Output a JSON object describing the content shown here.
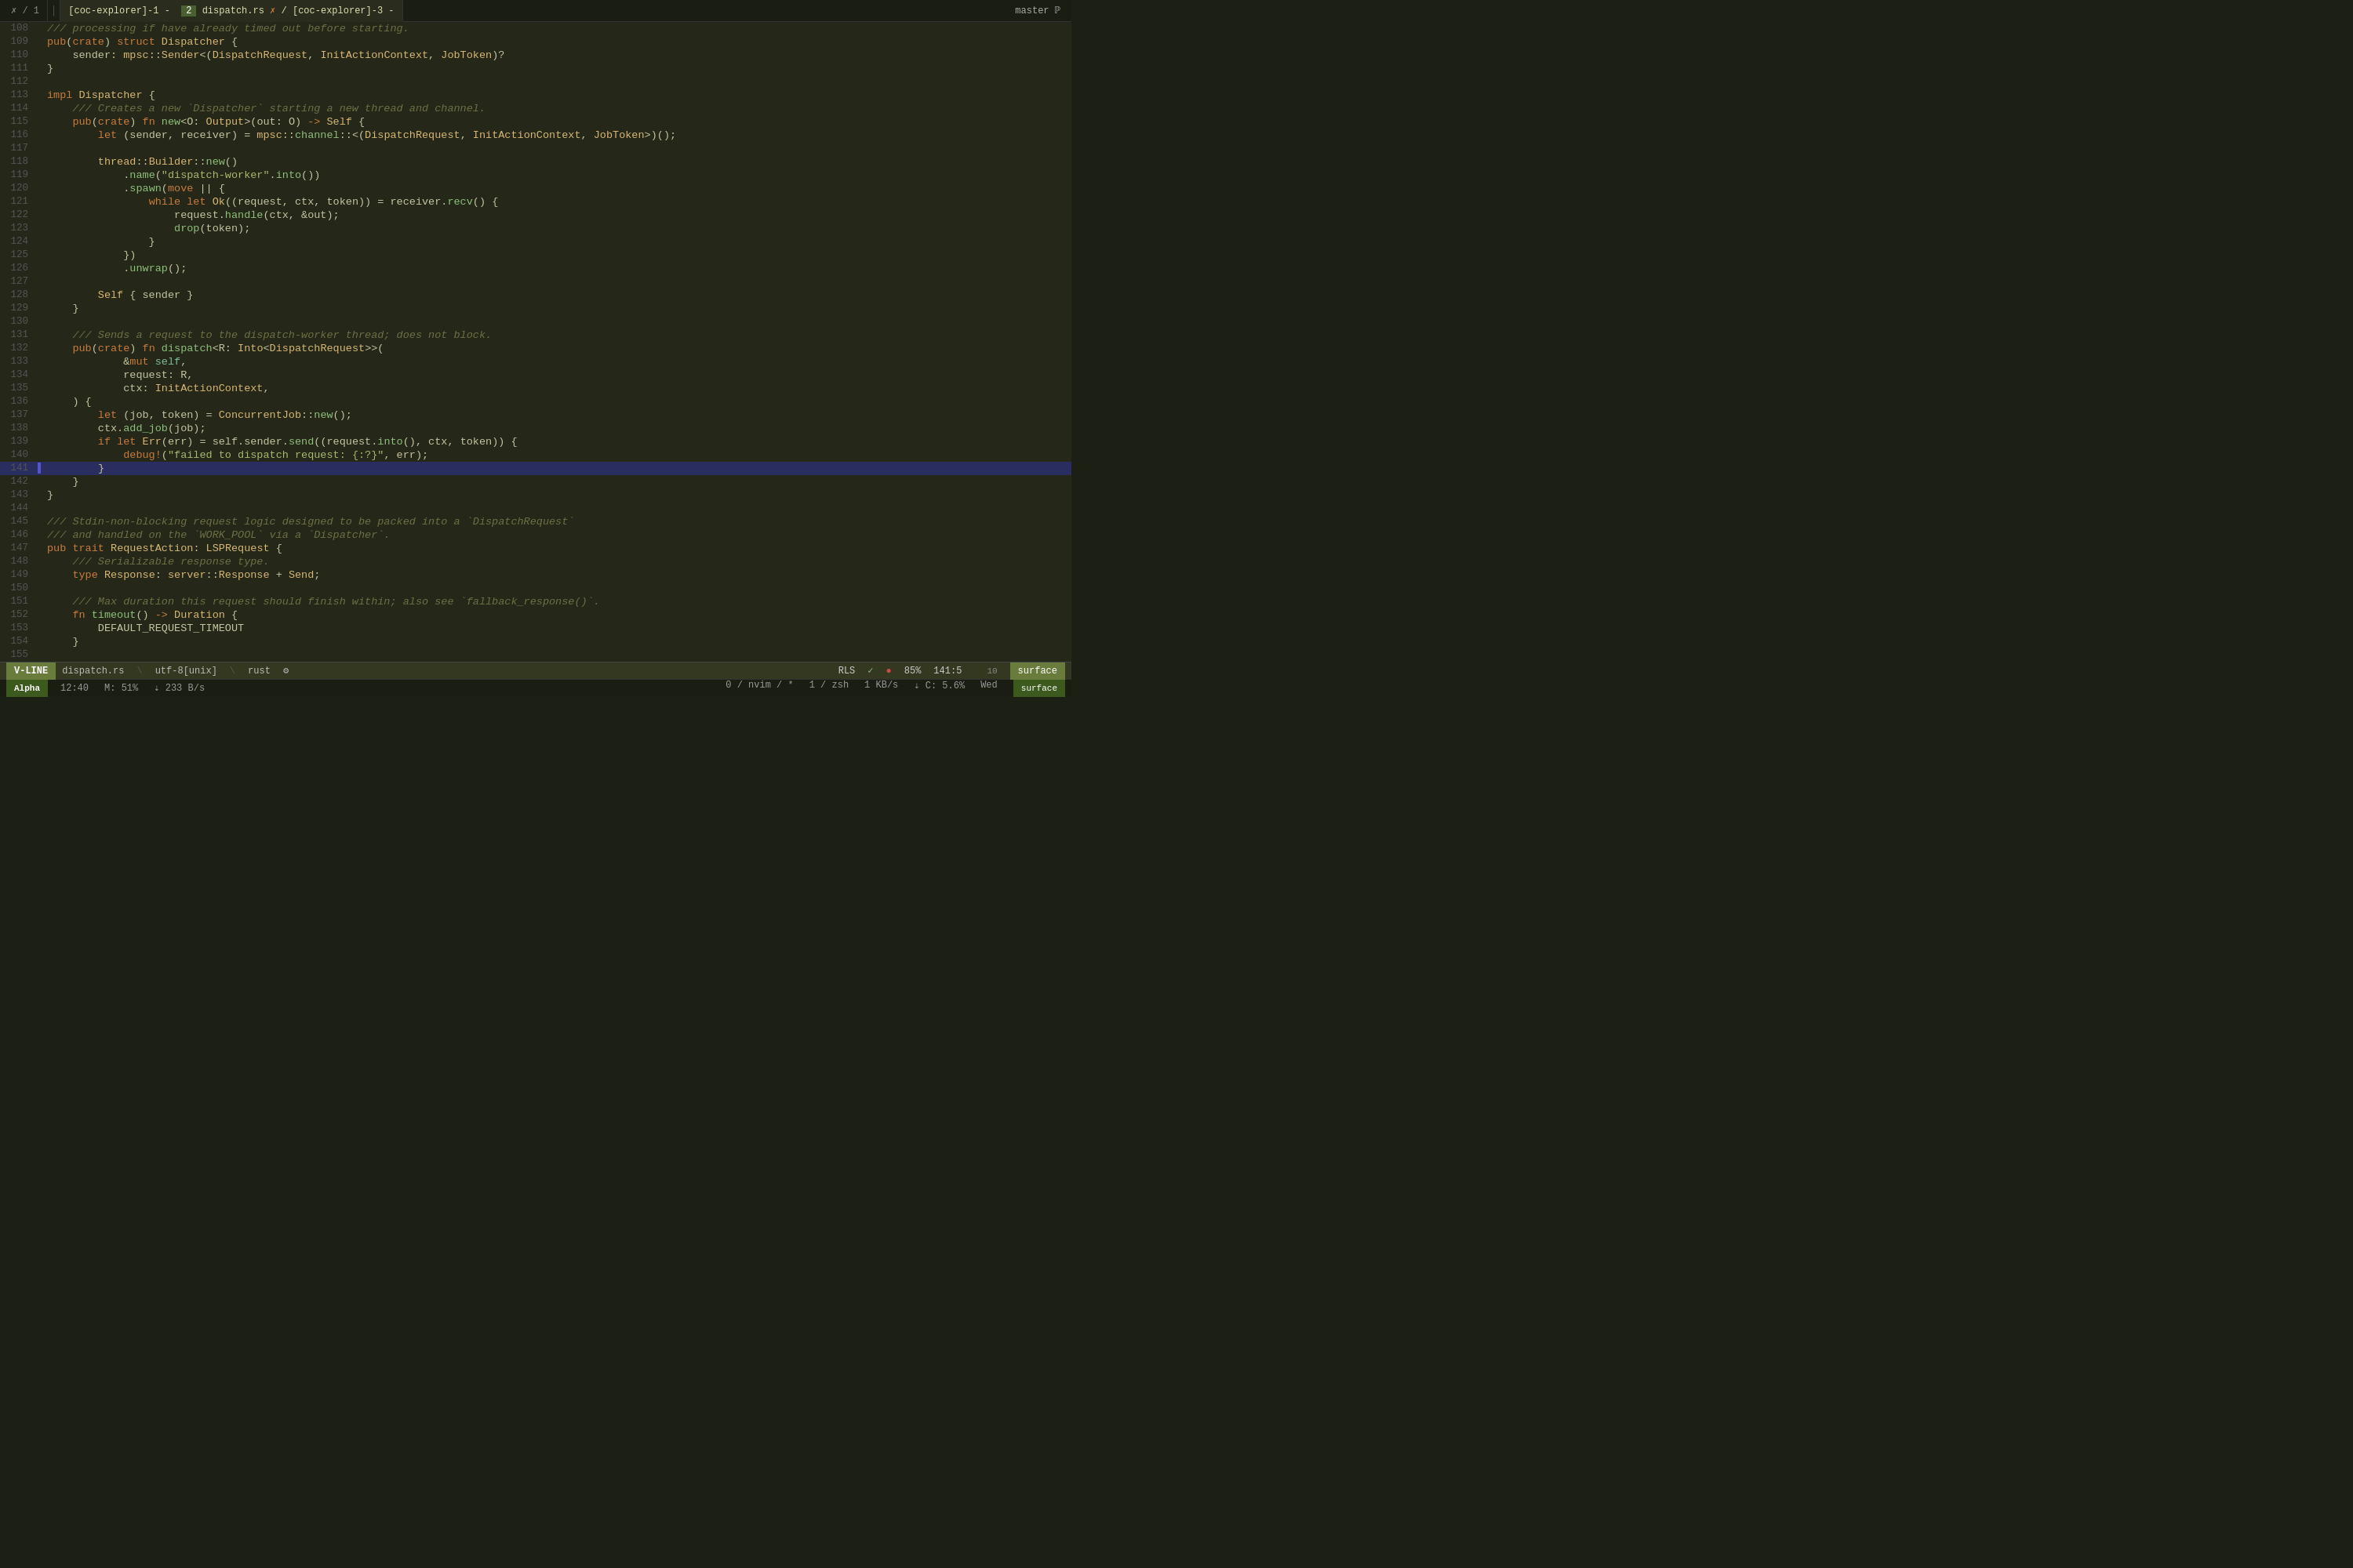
{
  "tabs": [
    {
      "id": 1,
      "label": "✗ / 1",
      "active": false
    },
    {
      "id": 2,
      "label": "[coc-explorer]-1 -  2  dispatch.rs  ✗ / [coc-explorer]-3 -",
      "active": true
    }
  ],
  "branch": "master ℙ",
  "filename": "dispatch.rs",
  "encoding": "utf-8[unix]",
  "filetype": "rust",
  "lsp": "RLS",
  "lsp_check": "✓",
  "lsp_dot": "●",
  "zoom": "85%",
  "position": "141:5",
  "scroll_pct": "10",
  "mode": "V-LINE",
  "time": "12:40",
  "mem": "M: 51%",
  "transfer": "⇣ 233 B/s",
  "nvim_info": "0 / nvim / *",
  "jobs": "1 / zsh",
  "kb": "1 KB/s",
  "cpu": "⇣ C: 5.6%",
  "day": "Wed",
  "surface": "surface",
  "lines": [
    {
      "n": 108,
      "indent": 0,
      "tokens": [
        {
          "t": "cmt",
          "v": "/// processing if have already timed out before starting."
        }
      ]
    },
    {
      "n": 109,
      "indent": 0,
      "tokens": [
        {
          "t": "kw",
          "v": "pub"
        },
        {
          "t": "normal",
          "v": "("
        },
        {
          "t": "kw",
          "v": "crate"
        },
        {
          "t": "normal",
          "v": ") "
        },
        {
          "t": "kw",
          "v": "struct"
        },
        {
          "t": "normal",
          "v": " "
        },
        {
          "t": "type",
          "v": "Dispatcher"
        },
        {
          "t": "normal",
          "v": " {"
        }
      ]
    },
    {
      "n": 110,
      "indent": 1,
      "tokens": [
        {
          "t": "normal",
          "v": "    sender: "
        },
        {
          "t": "type",
          "v": "mpsc"
        },
        {
          "t": "normal",
          "v": "::"
        },
        {
          "t": "type",
          "v": "Sender"
        },
        {
          "t": "normal",
          "v": "<("
        },
        {
          "t": "type",
          "v": "DispatchRequest"
        },
        {
          "t": "normal",
          "v": ", "
        },
        {
          "t": "type",
          "v": "InitActionContext"
        },
        {
          "t": "normal",
          "v": ", "
        },
        {
          "t": "type",
          "v": "JobToken"
        },
        {
          "t": "normal",
          "v": ")?"
        }
      ]
    },
    {
      "n": 111,
      "indent": 0,
      "tokens": [
        {
          "t": "normal",
          "v": "}"
        }
      ]
    },
    {
      "n": 112,
      "indent": 0,
      "tokens": []
    },
    {
      "n": 113,
      "indent": 0,
      "tokens": [
        {
          "t": "kw",
          "v": "impl"
        },
        {
          "t": "normal",
          "v": " "
        },
        {
          "t": "type",
          "v": "Dispatcher"
        },
        {
          "t": "normal",
          "v": " {"
        }
      ]
    },
    {
      "n": 114,
      "indent": 1,
      "tokens": [
        {
          "t": "normal",
          "v": "    "
        },
        {
          "t": "cmt",
          "v": "/// Creates a new `Dispatcher` starting a new thread and channel."
        }
      ]
    },
    {
      "n": 115,
      "indent": 1,
      "tokens": [
        {
          "t": "normal",
          "v": "    "
        },
        {
          "t": "kw",
          "v": "pub"
        },
        {
          "t": "normal",
          "v": "("
        },
        {
          "t": "kw",
          "v": "crate"
        },
        {
          "t": "normal",
          "v": ") "
        },
        {
          "t": "kw",
          "v": "fn"
        },
        {
          "t": "normal",
          "v": " "
        },
        {
          "t": "func",
          "v": "new"
        },
        {
          "t": "normal",
          "v": "<O: "
        },
        {
          "t": "type",
          "v": "Output"
        },
        {
          "t": "normal",
          "v": ">(out: O) "
        },
        {
          "t": "arrow",
          "v": "->"
        },
        {
          "t": "normal",
          "v": " "
        },
        {
          "t": "type",
          "v": "Self"
        },
        {
          "t": "normal",
          "v": " {"
        }
      ]
    },
    {
      "n": 116,
      "indent": 2,
      "tokens": [
        {
          "t": "normal",
          "v": "        "
        },
        {
          "t": "kw",
          "v": "let"
        },
        {
          "t": "normal",
          "v": " (sender, receiver) = "
        },
        {
          "t": "type",
          "v": "mpsc"
        },
        {
          "t": "normal",
          "v": "::"
        },
        {
          "t": "func",
          "v": "channel"
        },
        {
          "t": "normal",
          "v": "::<("
        },
        {
          "t": "type",
          "v": "DispatchRequest"
        },
        {
          "t": "normal",
          "v": ", "
        },
        {
          "t": "type",
          "v": "InitActionContext"
        },
        {
          "t": "normal",
          "v": ", "
        },
        {
          "t": "type",
          "v": "JobToken"
        },
        {
          "t": "normal",
          "v": ">)();"
        }
      ]
    },
    {
      "n": 117,
      "indent": 0,
      "tokens": []
    },
    {
      "n": 118,
      "indent": 2,
      "tokens": [
        {
          "t": "normal",
          "v": "        "
        },
        {
          "t": "type",
          "v": "thread"
        },
        {
          "t": "normal",
          "v": "::"
        },
        {
          "t": "type",
          "v": "Builder"
        },
        {
          "t": "normal",
          "v": "::"
        },
        {
          "t": "func",
          "v": "new"
        },
        {
          "t": "normal",
          "v": "()"
        }
      ]
    },
    {
      "n": 119,
      "indent": 3,
      "tokens": [
        {
          "t": "normal",
          "v": "            ."
        },
        {
          "t": "func",
          "v": "name"
        },
        {
          "t": "normal",
          "v": "("
        },
        {
          "t": "str",
          "v": "\"dispatch-worker\""
        },
        {
          "t": "normal",
          "v": "."
        },
        {
          "t": "func",
          "v": "into"
        },
        {
          "t": "normal",
          "v": "())"
        }
      ]
    },
    {
      "n": 120,
      "indent": 3,
      "tokens": [
        {
          "t": "normal",
          "v": "            ."
        },
        {
          "t": "func",
          "v": "spawn"
        },
        {
          "t": "normal",
          "v": "("
        },
        {
          "t": "kw",
          "v": "move"
        },
        {
          "t": "normal",
          "v": " || {"
        }
      ]
    },
    {
      "n": 121,
      "indent": 4,
      "tokens": [
        {
          "t": "normal",
          "v": "                "
        },
        {
          "t": "kw",
          "v": "while"
        },
        {
          "t": "normal",
          "v": " "
        },
        {
          "t": "kw",
          "v": "let"
        },
        {
          "t": "normal",
          "v": " "
        },
        {
          "t": "type",
          "v": "Ok"
        },
        {
          "t": "normal",
          "v": "((request, ctx, token)) = receiver."
        },
        {
          "t": "func",
          "v": "recv"
        },
        {
          "t": "normal",
          "v": "() {"
        }
      ]
    },
    {
      "n": 122,
      "indent": 5,
      "tokens": [
        {
          "t": "normal",
          "v": "                    request."
        },
        {
          "t": "func",
          "v": "handle"
        },
        {
          "t": "normal",
          "v": "(ctx, &out);"
        }
      ]
    },
    {
      "n": 123,
      "indent": 5,
      "tokens": [
        {
          "t": "normal",
          "v": "                    "
        },
        {
          "t": "func",
          "v": "drop"
        },
        {
          "t": "normal",
          "v": "(token);"
        }
      ]
    },
    {
      "n": 124,
      "indent": 4,
      "tokens": [
        {
          "t": "normal",
          "v": "                }"
        }
      ]
    },
    {
      "n": 125,
      "indent": 3,
      "tokens": [
        {
          "t": "normal",
          "v": "            })"
        }
      ]
    },
    {
      "n": 126,
      "indent": 3,
      "tokens": [
        {
          "t": "normal",
          "v": "            ."
        },
        {
          "t": "func",
          "v": "unwrap"
        },
        {
          "t": "normal",
          "v": "();"
        }
      ]
    },
    {
      "n": 127,
      "indent": 0,
      "tokens": []
    },
    {
      "n": 128,
      "indent": 2,
      "tokens": [
        {
          "t": "normal",
          "v": "        "
        },
        {
          "t": "type",
          "v": "Self"
        },
        {
          "t": "normal",
          "v": " { sender }"
        }
      ]
    },
    {
      "n": 129,
      "indent": 1,
      "tokens": [
        {
          "t": "normal",
          "v": "    }"
        }
      ]
    },
    {
      "n": 130,
      "indent": 0,
      "tokens": []
    },
    {
      "n": 131,
      "indent": 1,
      "tokens": [
        {
          "t": "normal",
          "v": "    "
        },
        {
          "t": "cmt",
          "v": "/// Sends a request to the dispatch-worker thread; does not block."
        }
      ]
    },
    {
      "n": 132,
      "indent": 1,
      "tokens": [
        {
          "t": "normal",
          "v": "    "
        },
        {
          "t": "kw",
          "v": "pub"
        },
        {
          "t": "normal",
          "v": "("
        },
        {
          "t": "kw",
          "v": "crate"
        },
        {
          "t": "normal",
          "v": ") "
        },
        {
          "t": "kw",
          "v": "fn"
        },
        {
          "t": "normal",
          "v": " "
        },
        {
          "t": "func",
          "v": "dispatch"
        },
        {
          "t": "normal",
          "v": "<R: "
        },
        {
          "t": "type",
          "v": "Into"
        },
        {
          "t": "normal",
          "v": "<"
        },
        {
          "t": "type",
          "v": "DispatchRequest"
        },
        {
          "t": "normal",
          "v": ">>( "
        }
      ]
    },
    {
      "n": 133,
      "indent": 2,
      "tokens": [
        {
          "t": "normal",
          "v": "            &"
        },
        {
          "t": "kw",
          "v": "mut"
        },
        {
          "t": "normal",
          "v": " "
        },
        {
          "t": "kw2",
          "v": "self"
        },
        {
          "t": "normal",
          "v": ","
        }
      ]
    },
    {
      "n": 134,
      "indent": 2,
      "tokens": [
        {
          "t": "normal",
          "v": "            request: R,"
        }
      ]
    },
    {
      "n": 135,
      "indent": 2,
      "tokens": [
        {
          "t": "normal",
          "v": "            ctx: "
        },
        {
          "t": "type",
          "v": "InitActionContext"
        },
        {
          "t": "normal",
          "v": ","
        }
      ]
    },
    {
      "n": 136,
      "indent": 1,
      "tokens": [
        {
          "t": "normal",
          "v": "    ) {"
        }
      ]
    },
    {
      "n": 137,
      "indent": 2,
      "tokens": [
        {
          "t": "normal",
          "v": "        "
        },
        {
          "t": "kw",
          "v": "let"
        },
        {
          "t": "normal",
          "v": " (job, token) = "
        },
        {
          "t": "type",
          "v": "ConcurrentJob"
        },
        {
          "t": "normal",
          "v": "::"
        },
        {
          "t": "func",
          "v": "new"
        },
        {
          "t": "normal",
          "v": "();"
        }
      ]
    },
    {
      "n": 138,
      "indent": 2,
      "tokens": [
        {
          "t": "normal",
          "v": "        ctx."
        },
        {
          "t": "func",
          "v": "add_job"
        },
        {
          "t": "normal",
          "v": "(job);"
        }
      ]
    },
    {
      "n": 139,
      "indent": 2,
      "tokens": [
        {
          "t": "normal",
          "v": "        "
        },
        {
          "t": "kw",
          "v": "if"
        },
        {
          "t": "normal",
          "v": " "
        },
        {
          "t": "kw",
          "v": "let"
        },
        {
          "t": "normal",
          "v": " "
        },
        {
          "t": "type",
          "v": "Err"
        },
        {
          "t": "normal",
          "v": "(err) = self.sender."
        },
        {
          "t": "func",
          "v": "send"
        },
        {
          "t": "normal",
          "v": "((request."
        },
        {
          "t": "func",
          "v": "into"
        },
        {
          "t": "normal",
          "v": "(), ctx, token)) {"
        }
      ]
    },
    {
      "n": 140,
      "indent": 3,
      "tokens": [
        {
          "t": "normal",
          "v": "            "
        },
        {
          "t": "mac",
          "v": "debug!"
        },
        {
          "t": "normal",
          "v": "("
        },
        {
          "t": "str",
          "v": "\"failed to dispatch request: {:?}\""
        },
        {
          "t": "normal",
          "v": ", err);"
        }
      ]
    },
    {
      "n": 141,
      "indent": 2,
      "tokens": [
        {
          "t": "normal",
          "v": "        }"
        }
      ],
      "selected": true
    },
    {
      "n": 142,
      "indent": 1,
      "tokens": [
        {
          "t": "normal",
          "v": "    }"
        }
      ]
    },
    {
      "n": 143,
      "indent": 0,
      "tokens": [
        {
          "t": "normal",
          "v": "}"
        }
      ]
    },
    {
      "n": 144,
      "indent": 0,
      "tokens": []
    },
    {
      "n": 145,
      "indent": 0,
      "tokens": [
        {
          "t": "cmt",
          "v": "/// Stdin-non-blocking request logic designed to be packed into a `DispatchRequest`"
        }
      ]
    },
    {
      "n": 146,
      "indent": 0,
      "tokens": [
        {
          "t": "cmt",
          "v": "/// and handled on the `WORK_POOL` via a `Dispatcher`."
        }
      ]
    },
    {
      "n": 147,
      "indent": 0,
      "tokens": [
        {
          "t": "kw",
          "v": "pub"
        },
        {
          "t": "normal",
          "v": " "
        },
        {
          "t": "kw",
          "v": "trait"
        },
        {
          "t": "normal",
          "v": " "
        },
        {
          "t": "type",
          "v": "RequestAction"
        },
        {
          "t": "normal",
          "v": ": "
        },
        {
          "t": "type",
          "v": "LSPRequest"
        },
        {
          "t": "normal",
          "v": " {"
        }
      ]
    },
    {
      "n": 148,
      "indent": 1,
      "tokens": [
        {
          "t": "normal",
          "v": "    "
        },
        {
          "t": "cmt",
          "v": "/// Serializable response type."
        }
      ]
    },
    {
      "n": 149,
      "indent": 1,
      "tokens": [
        {
          "t": "normal",
          "v": "    "
        },
        {
          "t": "kw",
          "v": "type"
        },
        {
          "t": "normal",
          "v": " "
        },
        {
          "t": "type",
          "v": "Response"
        },
        {
          "t": "normal",
          "v": ": "
        },
        {
          "t": "type",
          "v": "server"
        },
        {
          "t": "normal",
          "v": "::"
        },
        {
          "t": "type",
          "v": "Response"
        },
        {
          "t": "normal",
          "v": " + "
        },
        {
          "t": "type",
          "v": "Send"
        },
        {
          "t": "normal",
          "v": ";"
        }
      ]
    },
    {
      "n": 150,
      "indent": 0,
      "tokens": []
    },
    {
      "n": 151,
      "indent": 1,
      "tokens": [
        {
          "t": "normal",
          "v": "    "
        },
        {
          "t": "cmt",
          "v": "/// Max duration this request should finish within; also see `fallback_response()`."
        }
      ]
    },
    {
      "n": 152,
      "indent": 1,
      "tokens": [
        {
          "t": "normal",
          "v": "    "
        },
        {
          "t": "kw",
          "v": "fn"
        },
        {
          "t": "normal",
          "v": " "
        },
        {
          "t": "func",
          "v": "timeout"
        },
        {
          "t": "normal",
          "v": "() "
        },
        {
          "t": "arrow",
          "v": "->"
        },
        {
          "t": "normal",
          "v": " "
        },
        {
          "t": "type",
          "v": "Duration"
        },
        {
          "t": "normal",
          "v": " {"
        }
      ]
    },
    {
      "n": 153,
      "indent": 2,
      "tokens": [
        {
          "t": "normal",
          "v": "        DEFAULT_REQUEST_TIMEOUT"
        }
      ]
    },
    {
      "n": 154,
      "indent": 1,
      "tokens": [
        {
          "t": "normal",
          "v": "    }"
        }
      ]
    },
    {
      "n": 155,
      "indent": 0,
      "tokens": []
    }
  ]
}
